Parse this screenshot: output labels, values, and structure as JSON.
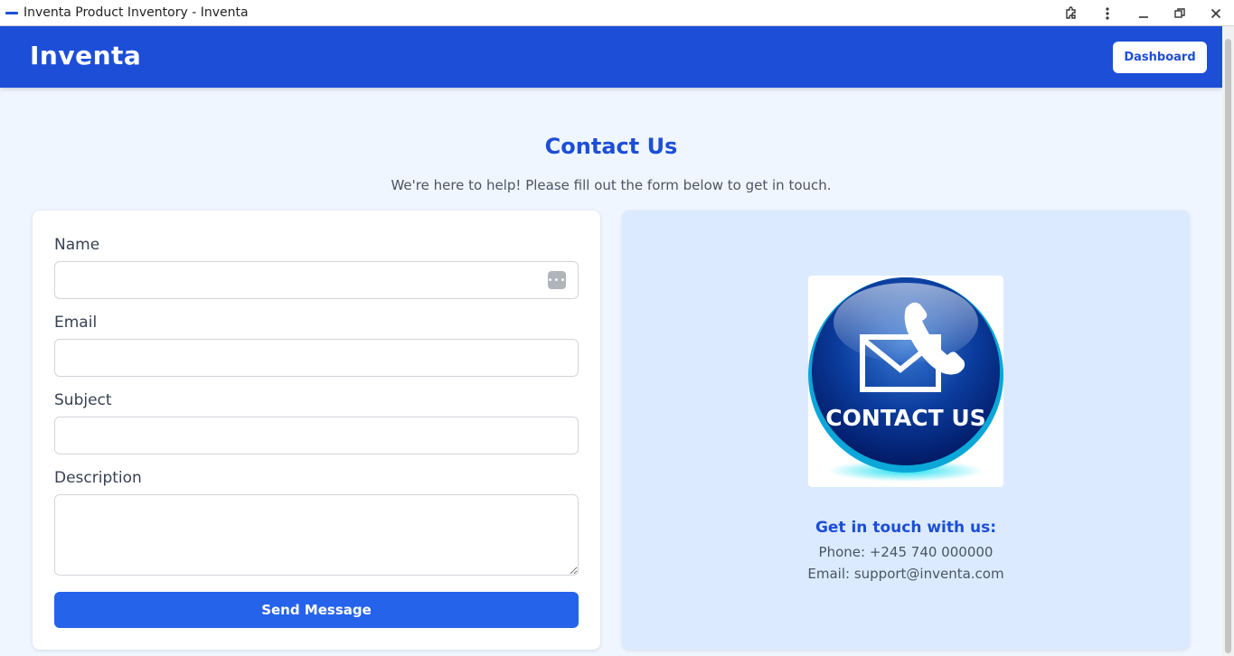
{
  "window": {
    "title": "Inventa Product Inventory - Inventa"
  },
  "header": {
    "brand": "Inventa",
    "dashboard_label": "Dashboard",
    "bg_color": "#1d4ed8"
  },
  "page": {
    "title": "Contact Us",
    "subtitle": "We're here to help! Please fill out the form below to get in touch."
  },
  "form": {
    "name_label": "Name",
    "name_value": "",
    "email_label": "Email",
    "email_value": "",
    "subject_label": "Subject",
    "subject_value": "",
    "description_label": "Description",
    "description_value": "",
    "submit_label": "Send Message",
    "accent": "#2563eb"
  },
  "info": {
    "image_text": "CONTACT US",
    "heading": "Get in touch with us:",
    "phone": "Phone: +245 740 000000",
    "email": "Email: support@inventa.com",
    "bg_color": "#dbeafe"
  },
  "icons": [
    "extension-icon",
    "more-vert-icon",
    "minimize-icon",
    "restore-icon",
    "close-icon",
    "password-manager-icon",
    "envelope-icon",
    "phone-icon"
  ]
}
